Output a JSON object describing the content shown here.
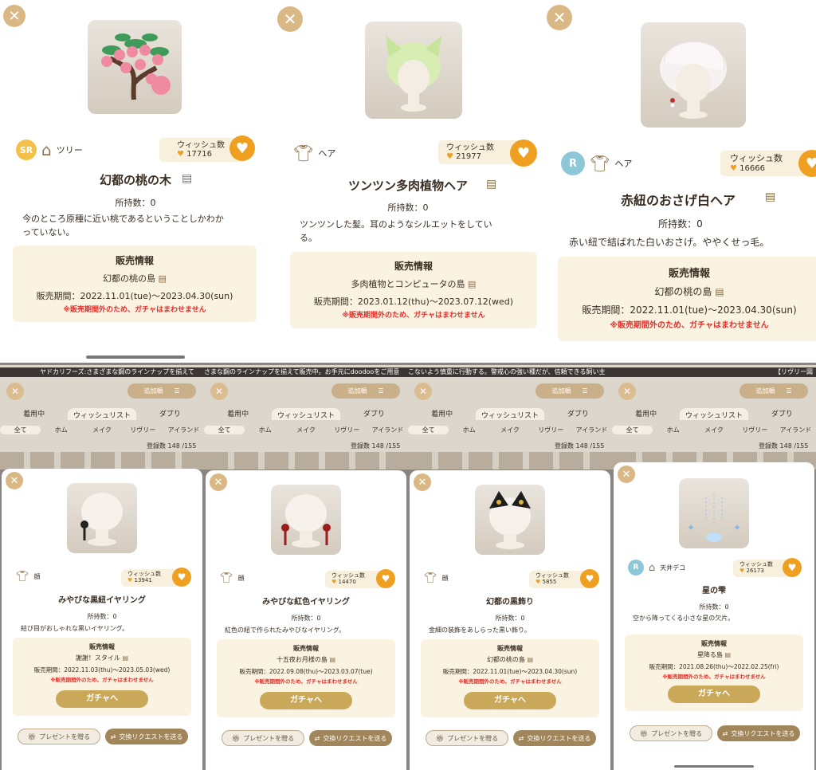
{
  "colors": {
    "accent": "#f0a020",
    "close": "#d9b886",
    "warn": "#e0302a",
    "gacha": "#c9a85a",
    "sale_bg": "#fbf3e2"
  },
  "top_cards": [
    {
      "rarity": "SR",
      "category": "ツリー",
      "wish_label": "ウィッシュ数",
      "wish_count": "17716",
      "name": "幻都の桃の木",
      "owned": "所持数：0",
      "desc": "今のところ原種に近い桃であるということしかわかっていない。",
      "sale_title": "販売情報",
      "island": "幻都の桃の島",
      "period": "販売期間：2022.11.01(tue)～2023.04.30(sun)",
      "warning": "※販売期間外のため、ガチャはまわせません"
    },
    {
      "rarity": "",
      "category": "ヘア",
      "wish_label": "ウィッシュ数",
      "wish_count": "21977",
      "name": "ツンツン多肉植物ヘア",
      "owned": "所持数：0",
      "desc": "ツンツンした髪。耳のようなシルエットをしている。",
      "sale_title": "販売情報",
      "island": "多肉植物とコンピュータの島",
      "period": "販売期間：2023.01.12(thu)～2023.07.12(wed)",
      "warning": "※販売期間外のため、ガチャはまわせません"
    },
    {
      "rarity": "R",
      "category": "ヘア",
      "wish_label": "ウィッシュ数",
      "wish_count": "16666",
      "name": "赤紐のおさげ白ヘア",
      "owned": "所持数：0",
      "desc": "赤い紐で結ばれた白いおさげ。ややくせっ毛。",
      "sale_title": "販売情報",
      "island": "幻都の桃の島",
      "period": "販売期間：2022.11.01(tue)～2023.04.30(sun)",
      "warning": "※販売期間外のため、ガチャはまわせません"
    }
  ],
  "lists": [
    {
      "marquee": "ヤドカリフーズ:さまざまな鋼のラインナップを揃えて",
      "sort": "追加順",
      "tabs": [
        "着用中",
        "ウィッシュリスト",
        "ダブり"
      ],
      "subtabs": [
        "全て",
        "ホム",
        "メイク",
        "リヴリー",
        "アイランド"
      ],
      "registered": "登録数 148 /155"
    },
    {
      "marquee": "さまな鋼のラインナップを揃えて販売中。お手元にdoodooをご用意",
      "sort": "追加順",
      "tabs": [
        "着用中",
        "ウィッシュリスト",
        "ダブり"
      ],
      "subtabs": [
        "全て",
        "ホム",
        "メイク",
        "リヴリー",
        "アイランド"
      ],
      "registered": "登録数 148 /155"
    },
    {
      "marquee": "こないよう慎重に行動する。警戒心の強い種だが、信頼できる飼い主",
      "sort": "追加順",
      "tabs": [
        "着用中",
        "ウィッシュリスト",
        "ダブり"
      ],
      "subtabs": [
        "全て",
        "ホム",
        "メイク",
        "リヴリー",
        "アイランド"
      ],
      "registered": "登録数 148 /155"
    },
    {
      "marquee": "【リヴリー図",
      "sort": "追加順",
      "tabs": [
        "着用中",
        "ウィッシュリスト",
        "ダブり"
      ],
      "subtabs": [
        "全て",
        "ホム",
        "メイク",
        "リヴリー",
        "アイランド"
      ],
      "registered": "登録数 148 /155"
    }
  ],
  "bottom_cards": [
    {
      "rarity": "",
      "category": "顔",
      "wish_label": "ウィッシュ数",
      "wish_count": "13941",
      "name": "みやびな黒紐イヤリング",
      "owned": "所持数：0",
      "desc": "結び目がおしゃれな黒いイヤリング。",
      "sale_title": "販売情報",
      "island": "謝謝！スタイル",
      "period": "販売期間：2022.11.03(thu)～2023.05.03(wed)",
      "warning": "※販売期間外のため、ガチャはまわせません",
      "gacha": "ガチャへ",
      "present": "プレゼントを贈る",
      "trade": "交換リクエストを送る"
    },
    {
      "rarity": "",
      "category": "顔",
      "wish_label": "ウィッシュ数",
      "wish_count": "14470",
      "name": "みやびな紅色イヤリング",
      "owned": "所持数：0",
      "desc": "紅色の紐で作られたみやびなイヤリング。",
      "sale_title": "販売情報",
      "island": "十五夜お月様の島",
      "period": "販売期間：2022.09.08(thu)～2023.03.07(tue)",
      "warning": "※販売期間外のため、ガチャはまわせません",
      "gacha": "ガチャへ",
      "present": "プレゼントを贈る",
      "trade": "交換リクエストを送る"
    },
    {
      "rarity": "",
      "category": "顔",
      "wish_label": "ウィッシュ数",
      "wish_count": "5855",
      "name": "幻都の黒飾り",
      "owned": "所持数：0",
      "desc": "金細の装飾をあしらった黒い飾り。",
      "sale_title": "販売情報",
      "island": "幻都の桃の島",
      "period": "販売期間：2022.11.01(tue)～2023.04.30(sun)",
      "warning": "※販売期間外のため、ガチャはまわせません",
      "gacha": "ガチャへ",
      "present": "プレゼントを贈る",
      "trade": "交換リクエストを送る"
    },
    {
      "rarity": "R",
      "category": "天井デコ",
      "wish_label": "ウィッシュ数",
      "wish_count": "26173",
      "name": "星の雫",
      "owned": "所持数：0",
      "desc": "空から降ってくる小さな星の欠片。",
      "sale_title": "販売情報",
      "island": "星降る島",
      "period": "販売期間：2021.08.26(thu)～2022.02.25(fri)",
      "warning": "※販売期間外のため、ガチャはまわせません",
      "gacha": "ガチャへ",
      "present": "プレゼントを贈る",
      "trade": "交換リクエストを送る"
    }
  ]
}
